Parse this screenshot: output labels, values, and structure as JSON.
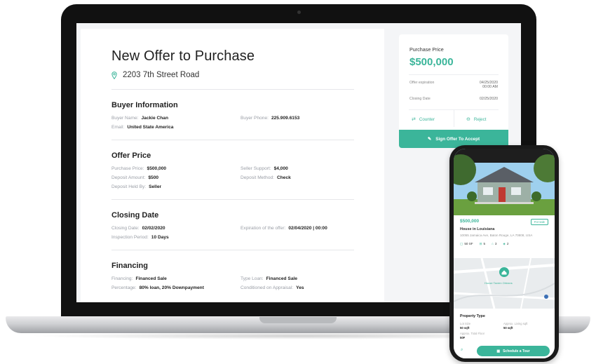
{
  "offer": {
    "title": "New Offer to Purchase",
    "address": "2203 7th Street Road",
    "sections": [
      {
        "title": "Buyer Information",
        "rows": [
          {
            "label": "Buyer Name:",
            "value": "Jackie Chan"
          },
          {
            "label": "Buyer Phone:",
            "value": "225.909.6153"
          },
          {
            "label": "Email:",
            "value": "United State America"
          }
        ]
      },
      {
        "title": "Offer Price",
        "rows": [
          {
            "label": "Purchase Price:",
            "value": "$500,000"
          },
          {
            "label": "Seller Support:",
            "value": "$4,000"
          },
          {
            "label": "Deposit Amount:",
            "value": "$500"
          },
          {
            "label": "Deposit Method:",
            "value": "Check"
          },
          {
            "label": "Deposit Held By:",
            "value": "Seller"
          }
        ]
      },
      {
        "title": "Closing Date",
        "rows": [
          {
            "label": "Closing Date:",
            "value": "02/02/2020"
          },
          {
            "label": "Expiration of the offer:",
            "value": "02/04/2020 | 00:00"
          },
          {
            "label": "Inspection Period:",
            "value": "10 Days"
          }
        ]
      },
      {
        "title": "Financing",
        "rows": [
          {
            "label": "Financing:",
            "value": "Financed Sale"
          },
          {
            "label": "Type Loan:",
            "value": "Financed Sale"
          },
          {
            "label": "Percentage:",
            "value": "80% loan, 20% Downpayment"
          },
          {
            "label": "Conditioned on Appraisal:",
            "value": "Yes"
          }
        ]
      }
    ]
  },
  "price_panel": {
    "label": "Purchase Price",
    "price": "$500,000",
    "rows": [
      {
        "label": "Offer expiration",
        "value": "04/25/2020 00:00 AM"
      },
      {
        "label": "Closing Date",
        "value": "02/25/2020"
      }
    ],
    "counter_label": "Counter",
    "reject_label": "Reject",
    "accept_label": "Sign Offer To Accept"
  },
  "phone": {
    "price": "$500,000",
    "badge": "For sale",
    "name": "House in Louisiana",
    "address": "10055 Jamaica Ave, Baton Rouge, LA 70808, USA",
    "features": [
      {
        "icon": "area-icon",
        "value": "50 SF"
      },
      {
        "icon": "bed-icon",
        "value": "5"
      },
      {
        "icon": "bath-icon",
        "value": "3"
      },
      {
        "icon": "car-icon",
        "value": "2"
      }
    ],
    "map_label": "House Tavern Orleans",
    "property_type_title": "Property Type",
    "property_rows": [
      {
        "label": "Lot Size",
        "value": "50 sqft"
      },
      {
        "label": "Approx. Living sqft",
        "value": "50 sqft"
      },
      {
        "label": "Approx. Total Floor",
        "value": "50F"
      },
      {
        "label": "",
        "value": ""
      }
    ],
    "tour_label": "Schedule a Tour"
  },
  "colors": {
    "accent": "#3bb59a",
    "laptop_bezel": "#111111",
    "screen_bg": "#f4f5f7"
  }
}
